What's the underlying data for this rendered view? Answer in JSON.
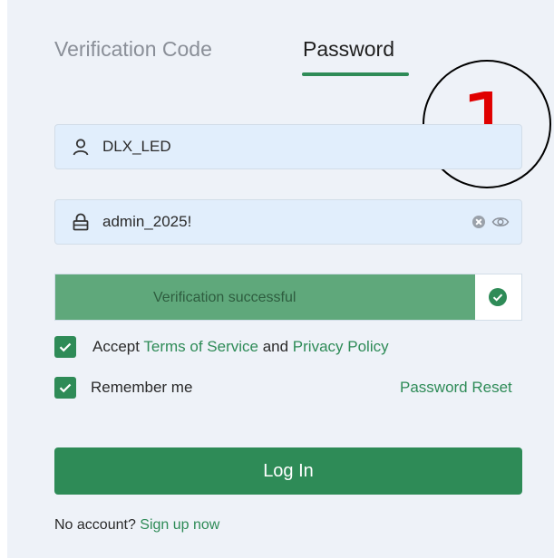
{
  "tabs": {
    "verification_code": "Verification Code",
    "password": "Password",
    "active": "password"
  },
  "badge": {
    "number": "1"
  },
  "username": {
    "value": "DLX_LED",
    "icon": "user-icon"
  },
  "password_field": {
    "value": "admin_2025!",
    "icon": "lock-icon",
    "clear_icon": "clear-icon",
    "visibility_icon": "eye-icon"
  },
  "verification": {
    "text": "Verification successful",
    "status": "success",
    "progress": 0.9,
    "icon": "check-circle-icon"
  },
  "agreement": {
    "checked": true,
    "prefix": "Accept ",
    "terms_link": "Terms of Service",
    "and": " and ",
    "privacy_link": "Privacy Policy"
  },
  "remember": {
    "checked": true,
    "label": "Remember me"
  },
  "password_reset_link": "Password Reset",
  "login_button": "Log In",
  "signup": {
    "prompt": "No account? ",
    "link": "Sign up now"
  },
  "colors": {
    "accent": "#2e8b57",
    "verify_bar": "#5fa87b",
    "field_bg": "#e1eefc",
    "panel_bg": "#eef2f8",
    "badge_number": "#e00000"
  }
}
